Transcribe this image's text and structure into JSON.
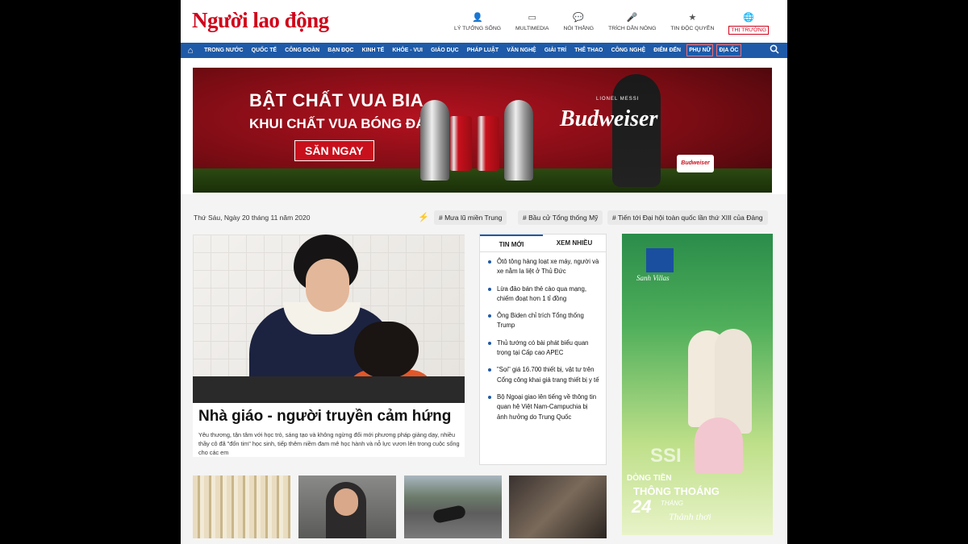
{
  "header": {
    "logo": "Người lao động",
    "top_links": [
      {
        "icon": "user-icon",
        "glyph": "👤",
        "label": "LÝ TƯỞNG SỐNG"
      },
      {
        "icon": "monitor-icon",
        "glyph": "▭",
        "label": "MULTIMEDIA"
      },
      {
        "icon": "chat-icon",
        "glyph": "💬",
        "label": "NÓI THẲNG"
      },
      {
        "icon": "microphone-icon",
        "glyph": "🎤",
        "label": "TRÍCH DẪN NÓNG"
      },
      {
        "icon": "star-icon",
        "glyph": "★",
        "label": "TIN ĐỘC QUYỀN"
      },
      {
        "icon": "globe-icon",
        "glyph": "🌐",
        "label": "THỊ TRƯỜNG"
      }
    ]
  },
  "nav": {
    "items": [
      "TRONG NƯỚC",
      "QUỐC TẾ",
      "CÔNG ĐOÀN",
      "BẠN ĐỌC",
      "KINH TẾ",
      "KHỎE - VUI",
      "GIÁO DỤC",
      "PHÁP LUẬT",
      "VĂN NGHỆ",
      "GIẢI TRÍ",
      "THỂ THAO",
      "CÔNG NGHỆ",
      "ĐIỂM ĐẾN",
      "PHỤ NỮ",
      "ĐỊA ỐC"
    ]
  },
  "banner": {
    "line1": "BẬT CHẤT VUA BIA",
    "line2": "KHUI CHẤT VUA BÓNG ĐÁ",
    "cta": "SĂN NGAY",
    "brand": "Budweiser",
    "player": "LIONEL MESSI",
    "badge": "Budweiser"
  },
  "date_row": {
    "date": "Thứ Sáu, Ngày 20 tháng 11 năm 2020",
    "tags": [
      "# Mưa lũ miền Trung",
      "# Bầu cử Tổng thống Mỹ",
      "# Tiến tới Đại hội toàn quốc lần thứ XIII của Đảng"
    ]
  },
  "lead": {
    "title": "Nhà giáo - người truyền cảm hứng",
    "sapo": "Yêu thương, tận tâm với học trò, sáng tạo và không ngừng đổi mới phương pháp giảng dạy, nhiều thầy cô đã \"đốn tim\" học sinh, tiếp thêm niềm đam mê học hành và nỗ lực vươn lên trong cuộc sống cho các em"
  },
  "tabs": {
    "tab1": "TIN MỚI",
    "tab2": "XEM NHIỀU",
    "news": [
      "Ôtô tông hàng loạt xe máy, người và xe nằm la liệt ở Thủ Đức",
      "Lừa đảo bán thẻ cào qua mạng, chiếm đoạt hơn 1 tỉ đồng",
      "Ông Biden chỉ trích Tổng thống Trump",
      "Thủ tướng có bài phát biểu quan trọng tại Cấp cao APEC",
      "\"Sọi\" giá 16.700 thiết bị, vật tư trên Cổng công khai giá trang thiết bị y tế",
      "Bộ Ngoại giao lên tiếng về thông tin quan hệ Việt Nam-Campuchia bị ảnh hưởng do Trung Quốc"
    ]
  },
  "ad": {
    "logo": "Sanh Villas",
    "watermark": "SSI",
    "slogan1": "DÒNG TIỀN",
    "slogan2": "THÔNG THOÁNG",
    "number": "24",
    "slogan3": "THÁNG",
    "slogan4": "Thảnh thơi"
  }
}
